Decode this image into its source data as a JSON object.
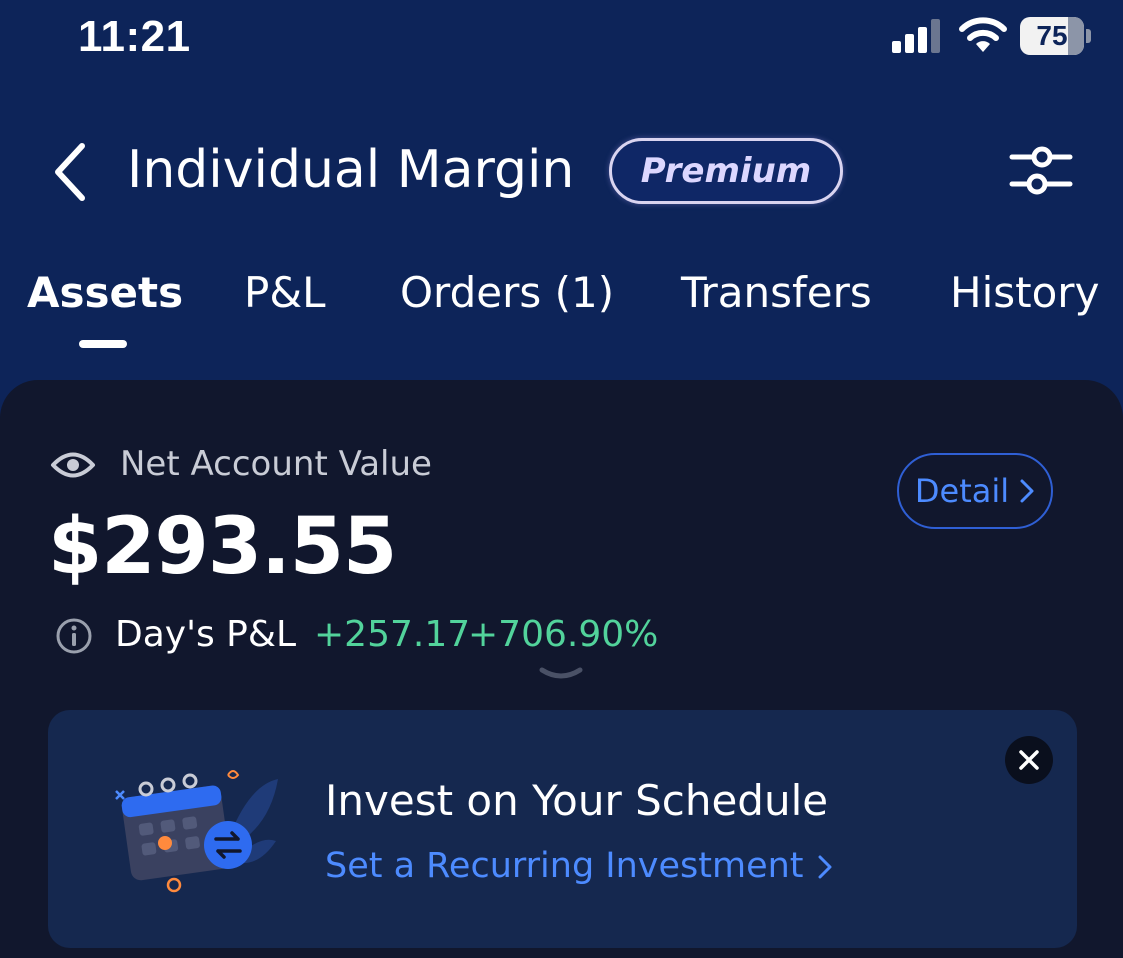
{
  "status_bar": {
    "time": "11:21",
    "battery": "75"
  },
  "header": {
    "title": "Individual Margin",
    "badge": "Premium"
  },
  "tabs": [
    {
      "label": "Assets",
      "active": true
    },
    {
      "label": "P&L",
      "active": false
    },
    {
      "label": "Orders (1)",
      "active": false
    },
    {
      "label": "Transfers",
      "active": false
    },
    {
      "label": "History",
      "active": false
    }
  ],
  "account": {
    "label": "Net Account Value",
    "value": "$293.55",
    "detail_label": "Detail",
    "day_pl_label": "Day's P&L",
    "day_pl_change": "+257.17",
    "day_pl_percent": "+706.90%"
  },
  "promo": {
    "title": "Invest on Your Schedule",
    "link": "Set a Recurring Investment"
  },
  "colors": {
    "header_bg": "#0d2459",
    "panel_bg": "#11172d",
    "accent_blue": "#4d8bff",
    "gain_green": "#52d39b"
  },
  "icons": [
    "signal-icon",
    "wifi-icon",
    "battery-icon",
    "back-arrow-icon",
    "settings-sliders-icon",
    "eye-icon",
    "chevron-right-icon",
    "info-icon",
    "chevron-down-icon",
    "calendar-illustration",
    "close-icon"
  ]
}
